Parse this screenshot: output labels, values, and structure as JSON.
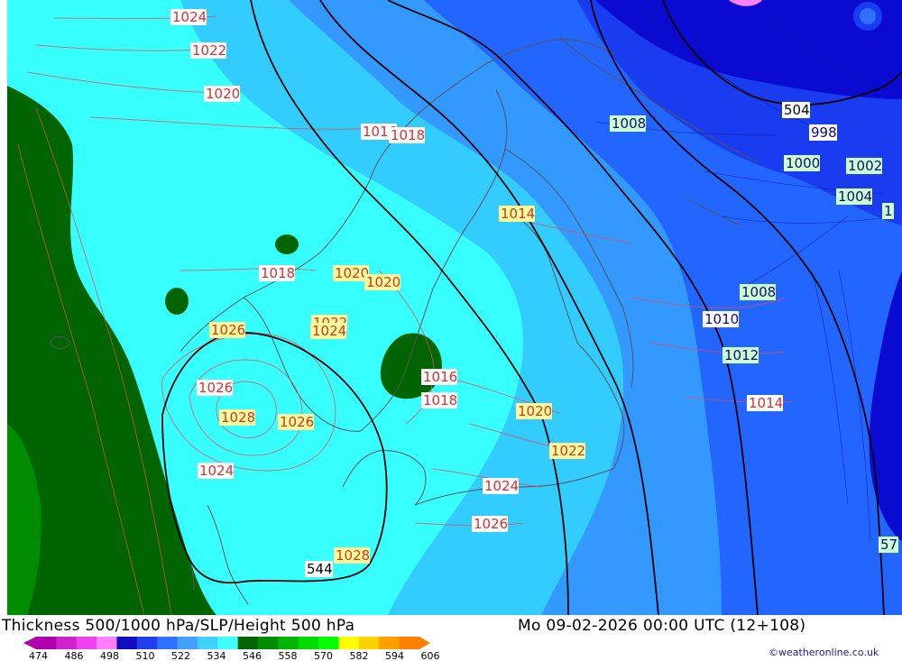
{
  "footer": {
    "title": "Thickness 500/1000 hPa/SLP/Height 500 hPa",
    "datetime": "Mo 09-02-2026 00:00 UTC (12+108)",
    "credit": "©weatheronline.co.uk"
  },
  "colorbar": {
    "labels": [
      "474",
      "486",
      "498",
      "510",
      "522",
      "534",
      "546",
      "558",
      "570",
      "582",
      "594",
      "606"
    ],
    "colors": [
      "#b000b0",
      "#d020d0",
      "#f040f0",
      "#ff80ff",
      "#1010c0",
      "#2040f0",
      "#3070ff",
      "#40a0ff",
      "#40d0ff",
      "#40ffff",
      "#006400",
      "#008c00",
      "#00b400",
      "#00dc00",
      "#00ff00",
      "#ffff00",
      "#ffd000",
      "#ffa000",
      "#ff8000"
    ]
  },
  "slp_labels": [
    {
      "text": "1024",
      "style": "red"
    },
    {
      "text": "1022",
      "style": "red"
    },
    {
      "text": "1020",
      "style": "red"
    },
    {
      "text": "1018",
      "style": "red"
    },
    {
      "text": "1016",
      "style": "red"
    },
    {
      "text": "1018",
      "style": "red"
    },
    {
      "text": "1020",
      "style": "yellow"
    },
    {
      "text": "1020",
      "style": "yellow"
    },
    {
      "text": "1022",
      "style": "yellow"
    },
    {
      "text": "1024",
      "style": "yellow"
    },
    {
      "text": "1026",
      "style": "yellow"
    },
    {
      "text": "1026",
      "style": "red"
    },
    {
      "text": "1028",
      "style": "yellow"
    },
    {
      "text": "1026",
      "style": "yellow"
    },
    {
      "text": "1024",
      "style": "red"
    },
    {
      "text": "1016",
      "style": "red"
    },
    {
      "text": "1018",
      "style": "red"
    },
    {
      "text": "1020",
      "style": "yellow"
    },
    {
      "text": "1022",
      "style": "yellow"
    },
    {
      "text": "1024",
      "style": "red"
    },
    {
      "text": "1026",
      "style": "red"
    },
    {
      "text": "1028",
      "style": "yellow"
    },
    {
      "text": "1014",
      "style": "yellow"
    },
    {
      "text": "1014",
      "style": "red"
    },
    {
      "text": "1012",
      "style": "green"
    },
    {
      "text": "1010",
      "style": "blue"
    },
    {
      "text": "1008",
      "style": "green"
    },
    {
      "text": "1008",
      "style": "green"
    },
    {
      "text": "1004",
      "style": "green"
    },
    {
      "text": "1002",
      "style": "green"
    },
    {
      "text": "1000",
      "style": "green"
    },
    {
      "text": "998",
      "style": "blue"
    },
    {
      "text": "1",
      "style": "green"
    },
    {
      "text": "57",
      "style": "green"
    }
  ],
  "height_labels": [
    {
      "text": "504"
    },
    {
      "text": "544"
    }
  ],
  "palette": {
    "cyan": "#38ffff",
    "light_blue": "#33ccff",
    "mid_blue": "#3399ff",
    "blue": "#2266ff",
    "deep_blue": "#1a3cf0",
    "navy": "#0a0ad0",
    "dark_green": "#006400"
  }
}
